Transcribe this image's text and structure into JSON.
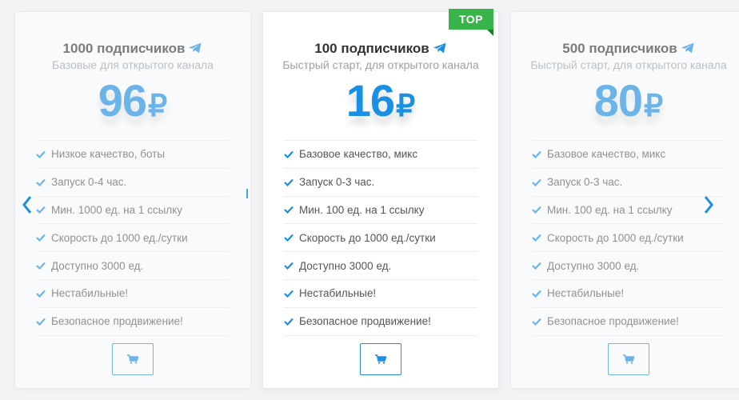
{
  "colors": {
    "accent": "#1a8fe3",
    "ribbon": "#37b44a",
    "text": "#333333",
    "muted": "#9aa0a6"
  },
  "cards": [
    {
      "badge": "",
      "title": "1000 подписчиков",
      "subtitle": "Базовые для открытого канала",
      "price": "96",
      "currency": "₽",
      "features": [
        "Низкое качество, боты",
        "Запуск 0-4 час.",
        "Мин. 1000 ед. на 1 ссылку",
        "Скорость до 1000 ед./сутки",
        "Доступно 3000 ед.",
        "Нестабильные!",
        "Безопасное продвижение!"
      ],
      "icons": {
        "title": "telegram-icon",
        "feature": "check-icon",
        "button": "cart-icon"
      }
    },
    {
      "badge": "TOP",
      "title": "100 подписчиков",
      "subtitle": "Быстрый старт, для открытого канала",
      "price": "16",
      "currency": "₽",
      "features": [
        "Базовое качество, микс",
        "Запуск 0-3 час.",
        "Мин. 100 ед. на 1 ссылку",
        "Скорость до 1000 ед./сутки",
        "Доступно 3000 ед.",
        "Нестабильные!",
        "Безопасное продвижение!"
      ],
      "icons": {
        "title": "telegram-icon",
        "feature": "check-icon",
        "button": "cart-icon"
      }
    },
    {
      "badge": "",
      "title": "500 подписчиков",
      "subtitle": "Быстрый старт, для открытого канала",
      "price": "80",
      "currency": "₽",
      "features": [
        "Базовое качество, микс",
        "Запуск 0-3 час.",
        "Мин. 100 ед. на 1 ссылку",
        "Скорость до 1000 ед./сутки",
        "Доступно 3000 ед.",
        "Нестабильные!",
        "Безопасное продвижение!"
      ],
      "icons": {
        "title": "telegram-icon",
        "feature": "check-icon",
        "button": "cart-icon"
      }
    }
  ],
  "navigation": {
    "prev_icon": "chevron-left-icon",
    "next_icon": "chevron-right-icon"
  }
}
